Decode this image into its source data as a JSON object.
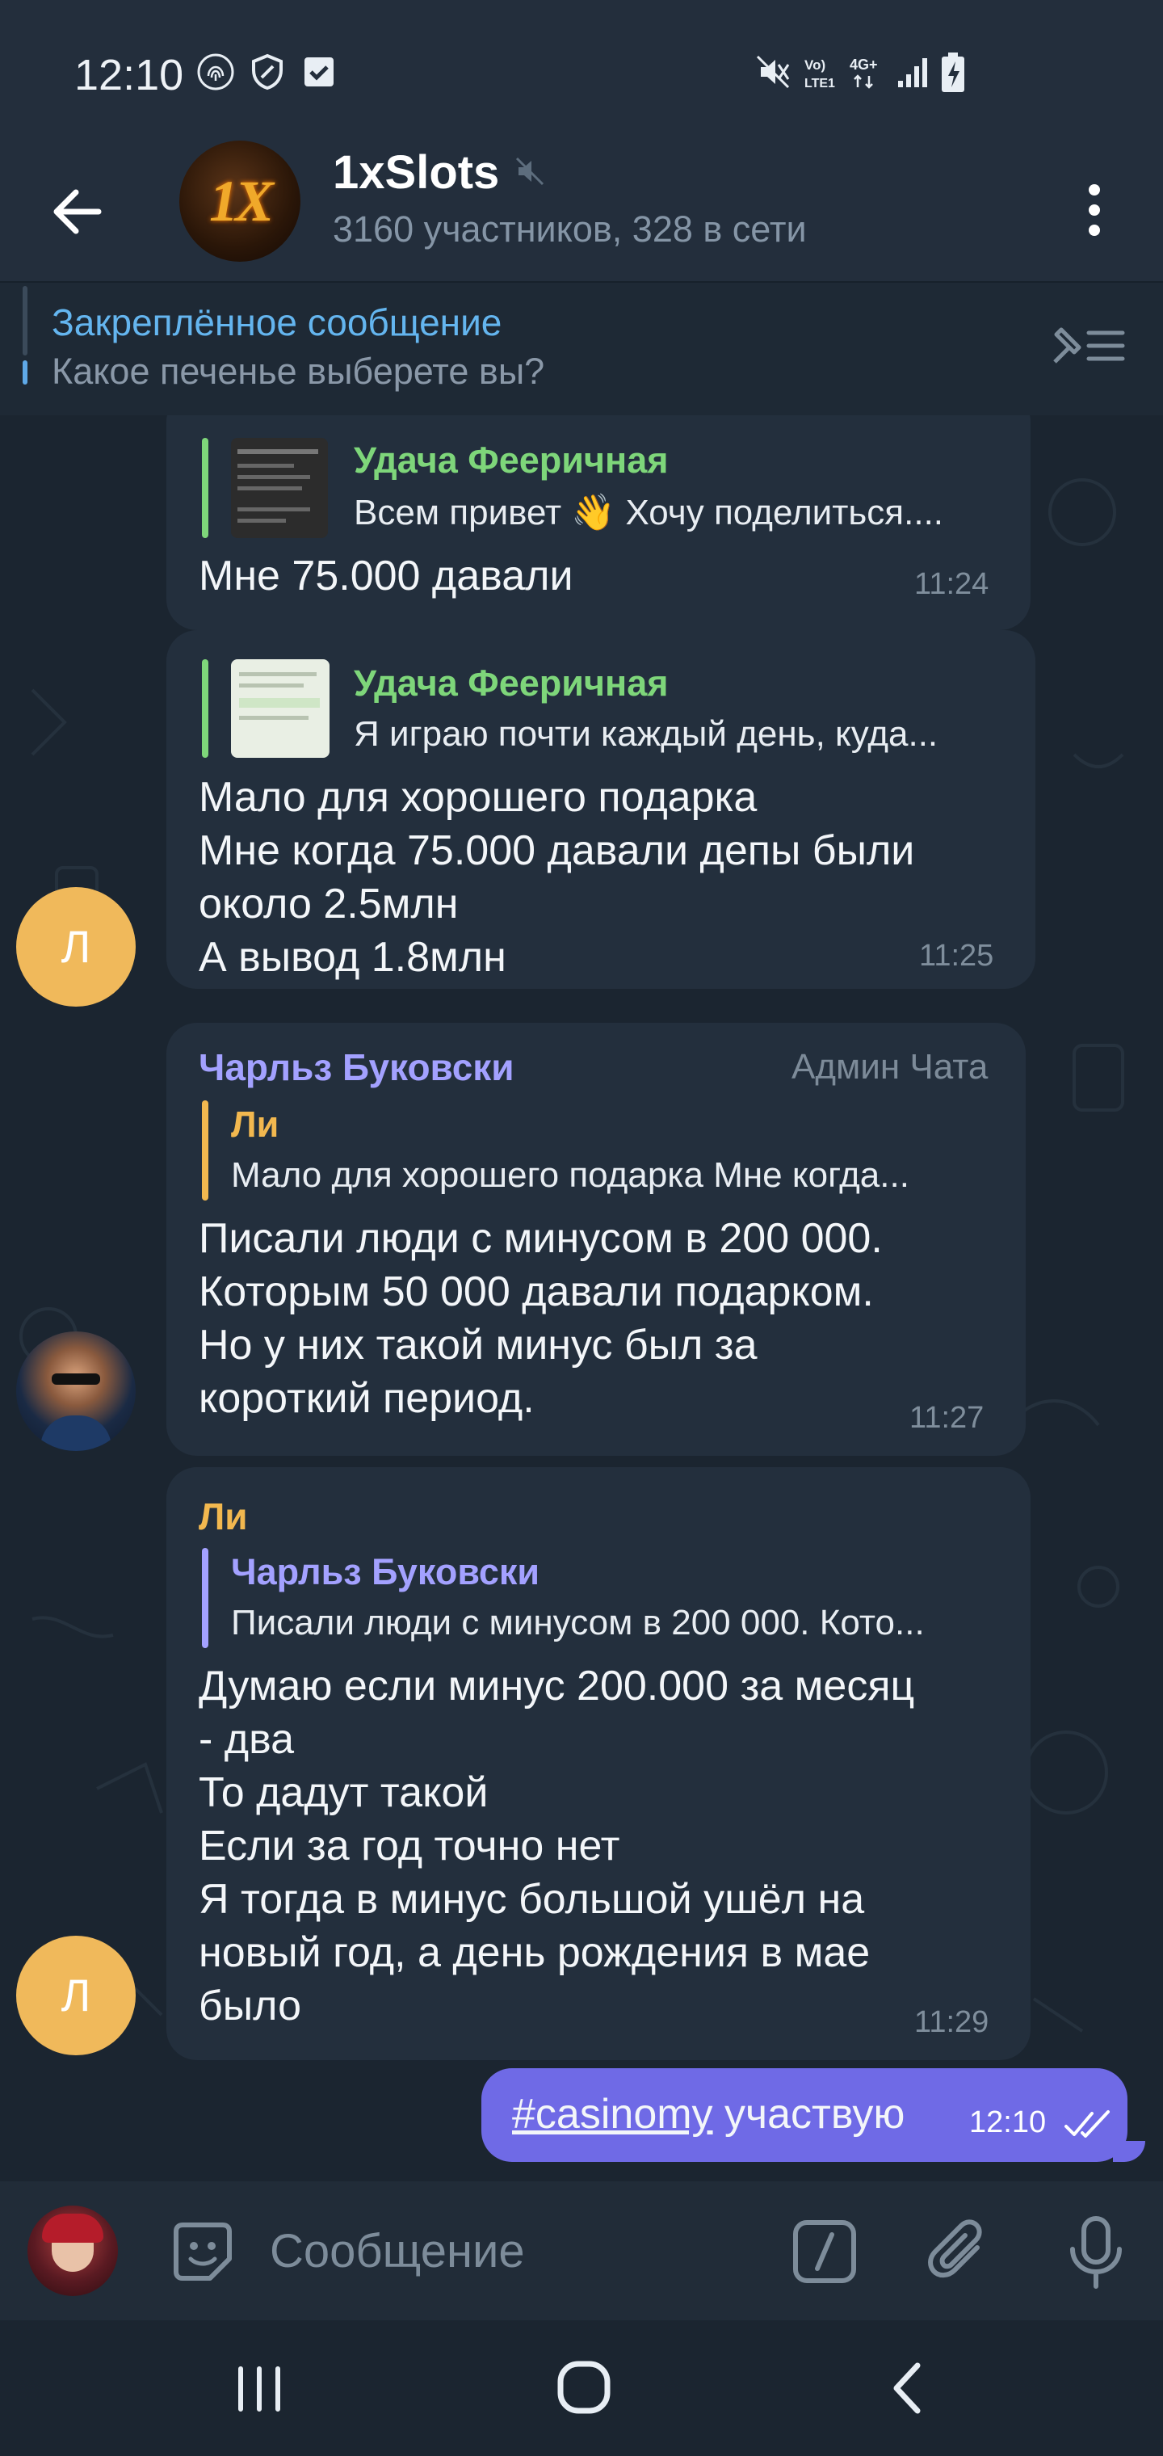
{
  "status_bar": {
    "time": "12:10",
    "icons": [
      "fingerprint-icon",
      "shield-icon",
      "check-square-icon",
      "mute-icon",
      "volte-icon",
      "4g-icon",
      "signal-icon",
      "battery-charging-icon"
    ],
    "network_label_1": "Vo)\nLTE1",
    "network_label_2": "4G+"
  },
  "header": {
    "title": "1xSlots",
    "subtitle": "3160 участников, 328 в сети",
    "avatar_text": "1X",
    "title_muted": true
  },
  "pinned": {
    "title": "Закреплённое сообщение",
    "text": "Какое печенье выберете вы?"
  },
  "messages": [
    {
      "reply_name": "Удача Фееричная",
      "reply_text": "Всем привет 👋 Хочу поделиться....",
      "text": "Мне 75.000 давали",
      "time": "11:24"
    },
    {
      "reply_name": "Удача Фееричная",
      "reply_text": "Я играю почти каждый день, куда...",
      "text": "Мало для хорошего подарка\nМне когда 75.000 давали депы были около 2.5млн\nА вывод 1.8млн",
      "time": "11:25",
      "avatar_letter": "Л"
    },
    {
      "sender": "Чарльз Буковски",
      "role": "Админ Чата",
      "reply_name": "Ли",
      "reply_text": "Мало для хорошего подарка  Мне когда...",
      "text": "Писали люди с минусом в 200 000.\nКоторым 50 000 давали подарком.\nНо у них такой минус был за\nкороткий период.",
      "time": "11:27"
    },
    {
      "sender": "Ли",
      "reply_name": "Чарльз Буковски",
      "reply_text": "Писали люди с минусом в 200 000. Кото...",
      "text": "Думаю если минус 200.000 за месяц\n- два\nТо дадут такой\nЕсли за год точно нет\nЯ тогда в минус большой ушёл на\nновый год, а день рождения в мае\nбыло",
      "time": "11:29",
      "avatar_letter": "Л"
    },
    {
      "outgoing": true,
      "hashtag": "#casinomy",
      "text": " участвую",
      "time": "12:10"
    }
  ],
  "input": {
    "placeholder": "Сообщение"
  },
  "colors": {
    "background": "#1b2530",
    "header": "#232e3c",
    "bubble_in": "#232f3d",
    "bubble_out": "#6f6ae6",
    "accent_blue": "#64b5ef",
    "name_green": "#7ed67a",
    "name_purple": "#a3a1ff",
    "name_orange": "#f2b84f"
  }
}
